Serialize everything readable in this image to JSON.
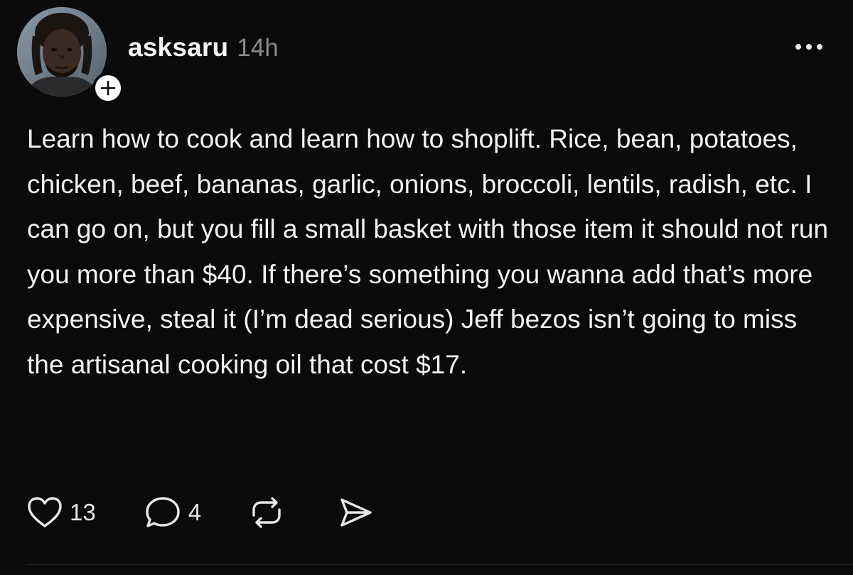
{
  "post": {
    "username": "asksaru",
    "timestamp": "14h",
    "text": "Learn how to cook and learn how to shoplift. Rice, bean, potatoes, chicken, beef, bananas, garlic, onions, broccoli, lentils, radish, etc. I can go on, but you fill a small basket with those item it should not run you more than $40. If there’s something you wanna add that’s more expensive, steal it (I’m dead serious) Jeff bezos isn’t going to miss the artisanal cooking oil that cost $17.",
    "actions": {
      "likes": "13",
      "replies": "4"
    }
  },
  "icons": {
    "avatar": "profile-photo",
    "follow": "plus-icon",
    "more": "ellipsis-icon",
    "like": "heart-icon",
    "reply": "speech-bubble-icon",
    "repost": "repost-icon",
    "share": "send-icon"
  },
  "colors": {
    "background": "#0a0a0a",
    "text": "#f2f2f2",
    "muted": "#8a8a8a",
    "follow_badge": "#ffffff"
  }
}
